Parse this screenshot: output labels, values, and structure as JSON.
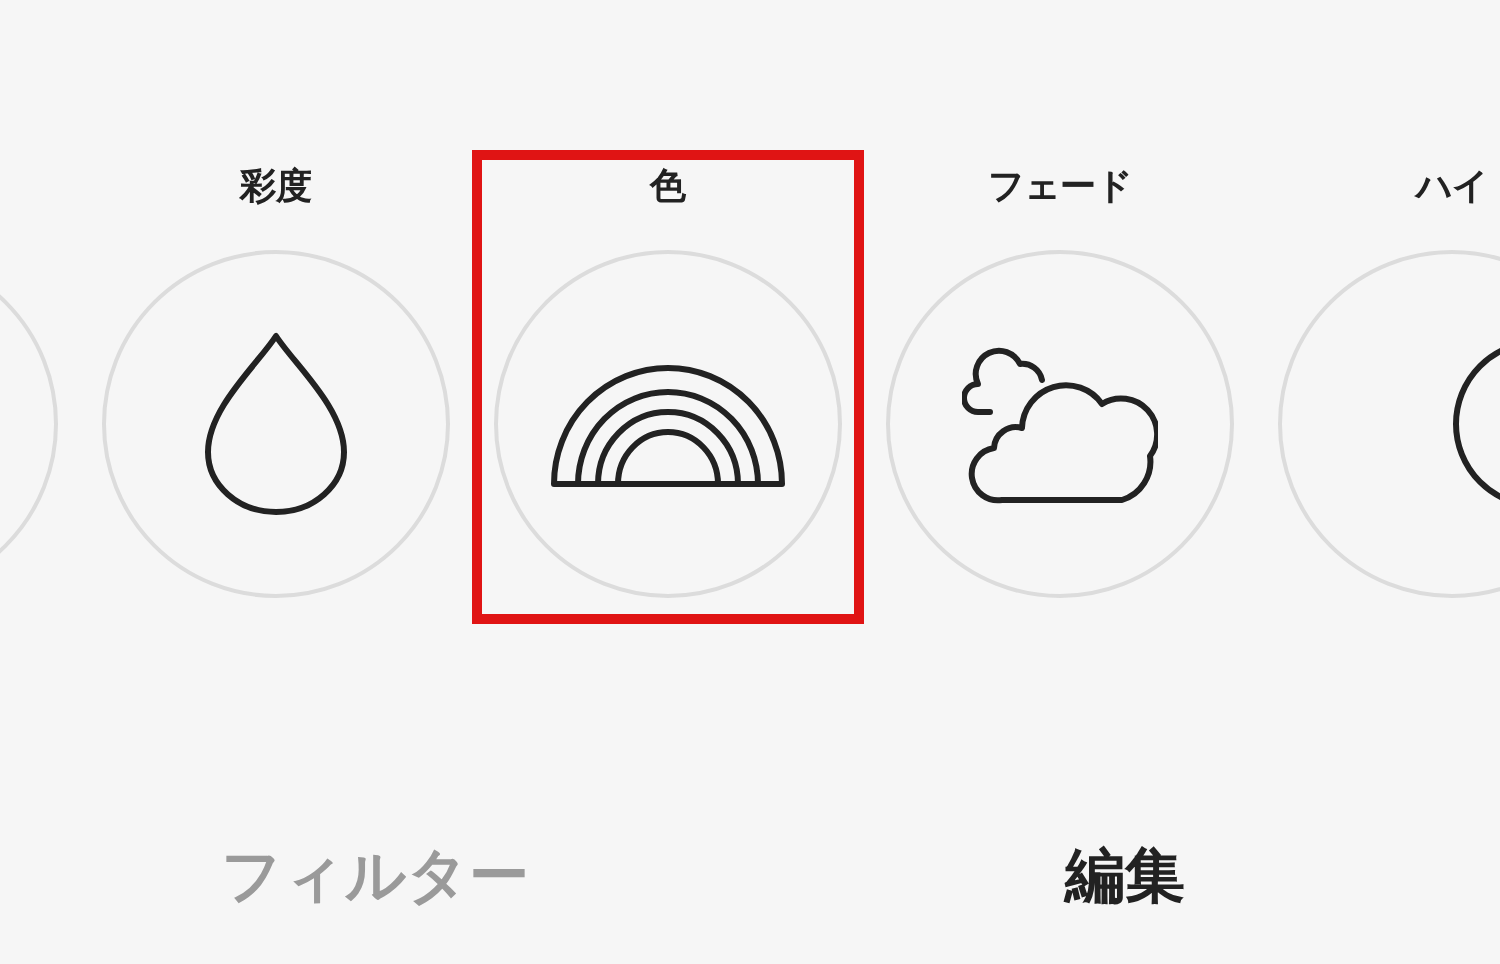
{
  "tools": [
    {
      "kind": "blank",
      "selected": false
    },
    {
      "kind": "drop",
      "label": "彩度",
      "selected": false
    },
    {
      "kind": "rainbow",
      "label": "色",
      "selected": true
    },
    {
      "kind": "clouds",
      "label": "フェード",
      "selected": false
    },
    {
      "kind": "lines",
      "label": "ハイ",
      "selected": false
    }
  ],
  "tabs": [
    {
      "label": "フィルター",
      "selected": false
    },
    {
      "label": "編集",
      "selected": true
    }
  ]
}
